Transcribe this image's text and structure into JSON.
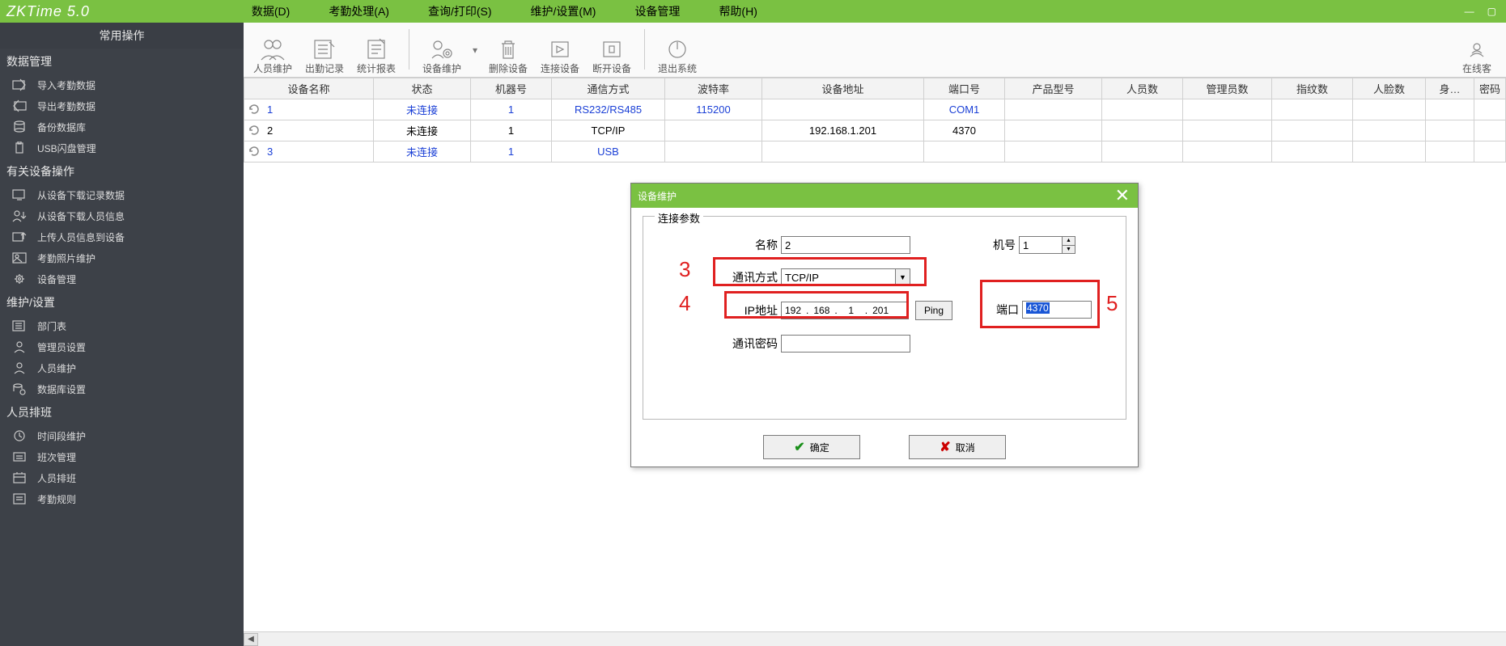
{
  "app": {
    "title": "ZKTime 5.0"
  },
  "menu": {
    "data": "数据(D)",
    "attendance": "考勤处理(A)",
    "query": "查询/打印(S)",
    "maintain": "维护/设置(M)",
    "device_mgmt": "设备管理",
    "help": "帮助(H)"
  },
  "sidebar": {
    "header": "常用操作",
    "groups": {
      "data_mgmt": {
        "title": "数据管理",
        "items": [
          "导入考勤数据",
          "导出考勤数据",
          "备份数据库",
          "USB闪盘管理"
        ]
      },
      "device_ops": {
        "title": "有关设备操作",
        "items": [
          "从设备下载记录数据",
          "从设备下载人员信息",
          "上传人员信息到设备",
          "考勤照片维护",
          "设备管理"
        ]
      },
      "maint": {
        "title": "维护/设置",
        "items": [
          "部门表",
          "管理员设置",
          "人员维护",
          "数据库设置"
        ]
      },
      "schedule": {
        "title": "人员排班",
        "items": [
          "时间段维护",
          "班次管理",
          "人员排班",
          "考勤规则"
        ]
      }
    }
  },
  "toolbar": {
    "person": "人员维护",
    "attlog": "出勤记录",
    "report": "统计报表",
    "device": "设备维护",
    "delete": "删除设备",
    "connect": "连接设备",
    "disconnect": "断开设备",
    "exit": "退出系统",
    "online": "在线客"
  },
  "table": {
    "headers": {
      "name": "设备名称",
      "status": "状态",
      "machine_no": "机器号",
      "comm": "通信方式",
      "baud": "波特率",
      "addr": "设备地址",
      "port": "端口号",
      "model": "产品型号",
      "users": "人员数",
      "admins": "管理员数",
      "fp": "指纹数",
      "face": "人脸数",
      "height": "身…",
      "pwd": "密码"
    },
    "rows": [
      {
        "name": "1",
        "status": "未连接",
        "machine_no": "1",
        "comm": "RS232/RS485",
        "baud": "115200",
        "addr": "",
        "port": "COM1",
        "cls": "blue-row"
      },
      {
        "name": "2",
        "status": "未连接",
        "machine_no": "1",
        "comm": "TCP/IP",
        "baud": "",
        "addr": "192.168.1.201",
        "port": "4370",
        "cls": "black-row"
      },
      {
        "name": "3",
        "status": "未连接",
        "machine_no": "1",
        "comm": "USB",
        "baud": "",
        "addr": "",
        "port": "",
        "cls": "blue-row"
      }
    ]
  },
  "dialog": {
    "title": "设备维护",
    "legend": "连接参数",
    "labels": {
      "name": "名称",
      "machine_no": "机号",
      "comm": "通讯方式",
      "ip": "IP地址",
      "port": "端口",
      "password": "通讯密码"
    },
    "values": {
      "name": "2",
      "machine_no": "1",
      "comm": "TCP/IP",
      "ip": {
        "a": "192",
        "b": "168",
        "c": "1",
        "d": "201"
      },
      "port": "4370",
      "password": ""
    },
    "buttons": {
      "ping": "Ping",
      "ok": "确定",
      "cancel": "取消"
    }
  },
  "markers": {
    "m3": "3",
    "m4": "4",
    "m5": "5"
  }
}
